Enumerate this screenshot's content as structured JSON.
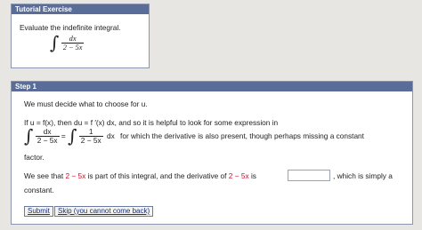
{
  "tutorial": {
    "header": "Tutorial Exercise",
    "prompt": "Evaluate the indefinite integral.",
    "integral": {
      "symbol": "∫",
      "numerator": "dx",
      "denominator": "2 − 5x"
    }
  },
  "step": {
    "header": "Step 1",
    "line1": "We must decide what to choose for u.",
    "line2_prefix": "If  u = f(x),  then  du = f ′(x) dx,  and so it is helpful to look for some expression in",
    "eq": {
      "lhs_num": "dx",
      "lhs_den": "2 − 5x",
      "equals": "=",
      "rhs_num": "1",
      "rhs_den": "2 − 5x",
      "rhs_tail": "dx",
      "suffix": "for which the derivative is also present, though perhaps missing a constant"
    },
    "line3": "factor.",
    "line4": {
      "prefix": "We see that",
      "expr1": "2 − 5x",
      "middle": "is part of this integral, and the derivative of",
      "expr2": "2 − 5x",
      "is": "is",
      "answer_value": "",
      "suffix": ", which is simply a",
      "end": "constant."
    },
    "buttons": {
      "submit": "Submit",
      "skip": "Skip (you cannot come back)"
    }
  }
}
